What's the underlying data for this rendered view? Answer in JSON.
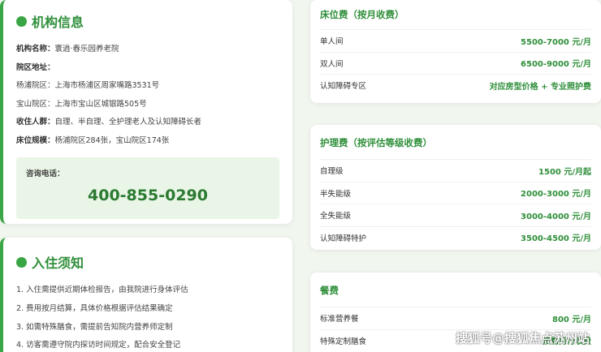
{
  "info_card": {
    "title": "机构信息",
    "rows": [
      {
        "k": "机构名称：",
        "v": "寰逍·春乐园养老院"
      },
      {
        "k": "院区地址：",
        "v": ""
      },
      {
        "k": "",
        "v": "杨浦院区：上海市杨浦区周家嘴路3531号"
      },
      {
        "k": "",
        "v": "宝山院区：上海市宝山区城银路505号"
      },
      {
        "k": "收住人群：",
        "v": "自理、半自理、全护理老人及认知障碍长者"
      },
      {
        "k": "床位规模：",
        "v": "杨浦院区284张，宝山院区174张"
      }
    ],
    "contact_label": "咨询电话：",
    "contact_phone": "400-855-0290"
  },
  "notice_card": {
    "title": "入住须知",
    "items": [
      "1. 入住需提供近期体检报告，由我院进行身体评估",
      "2. 费用按月结算，具体价格根据评估结果确定",
      "3. 如需特殊膳食，需提前告知院内营养师定制",
      "4. 访客需遵守院内探访时间规定，配合安全登记"
    ]
  },
  "bed_card": {
    "title": "床位费（按月收费）",
    "rows": [
      {
        "name": "单人间",
        "price": "5500-7000 元/月"
      },
      {
        "name": "双人间",
        "price": "6500-9000 元/月"
      },
      {
        "name": "认知障碍专区",
        "price": "对应房型价格 + 专业照护费"
      }
    ]
  },
  "care_card": {
    "title": "护理费（按评估等级收费）",
    "rows": [
      {
        "name": "自理级",
        "price": "1500 元/月起"
      },
      {
        "name": "半失能级",
        "price": "2000-3000 元/月"
      },
      {
        "name": "全失能级",
        "price": "3000-4000 元/月"
      },
      {
        "name": "认知障碍特护",
        "price": "3500-4500 元/月"
      }
    ]
  },
  "meal_card": {
    "title": "餐费",
    "rows": [
      {
        "name": "标准营养餐",
        "price": "800 元/月"
      },
      {
        "name": "特殊定制膳食",
        "price": "按需另行收费"
      }
    ]
  },
  "watermark": "搜狐号@搜狐焦点苏州站",
  "colors": {
    "accent": "#3aa544",
    "price": "#2f8f3a",
    "contact_bg": "#e9f5e6",
    "page_bg": "#f1f6ef"
  }
}
